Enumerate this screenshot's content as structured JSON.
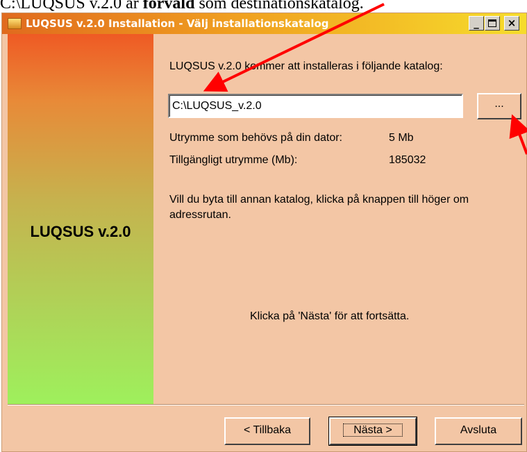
{
  "caption": {
    "prefix": "C:\\LUQSUS v.2.0 är ",
    "bold": "förvald",
    "suffix": " som destinationskatalog."
  },
  "window": {
    "title": "LUQSUS v.2.0 Installation - Välj installationskatalog",
    "minimize_label": "_",
    "close_label": "×"
  },
  "sidebar": {
    "product_name": "LUQSUS v.2.0"
  },
  "main": {
    "intro": "LUQSUS v.2.0 kommer att installeras i följande katalog:",
    "path_value": "C:\\LUQSUS_v.2.0",
    "browse_label": "...",
    "space_needed_label": "Utrymme som behövs på din dator:",
    "space_needed_value": "5 Mb",
    "space_available_label": "Tillgängligt utrymme (Mb):",
    "space_available_value": "185032",
    "change_hint": "Vill du byta till annan katalog, klicka på knappen till höger om adressrutan.",
    "continue_hint": "Klicka på 'Nästa' för att fortsätta."
  },
  "buttons": {
    "back": "< Tillbaka",
    "next": "Nästa >",
    "cancel": "Avsluta"
  },
  "colors": {
    "window_bg": "#f3c6a5",
    "annotation_arrow": "#ff0000"
  }
}
